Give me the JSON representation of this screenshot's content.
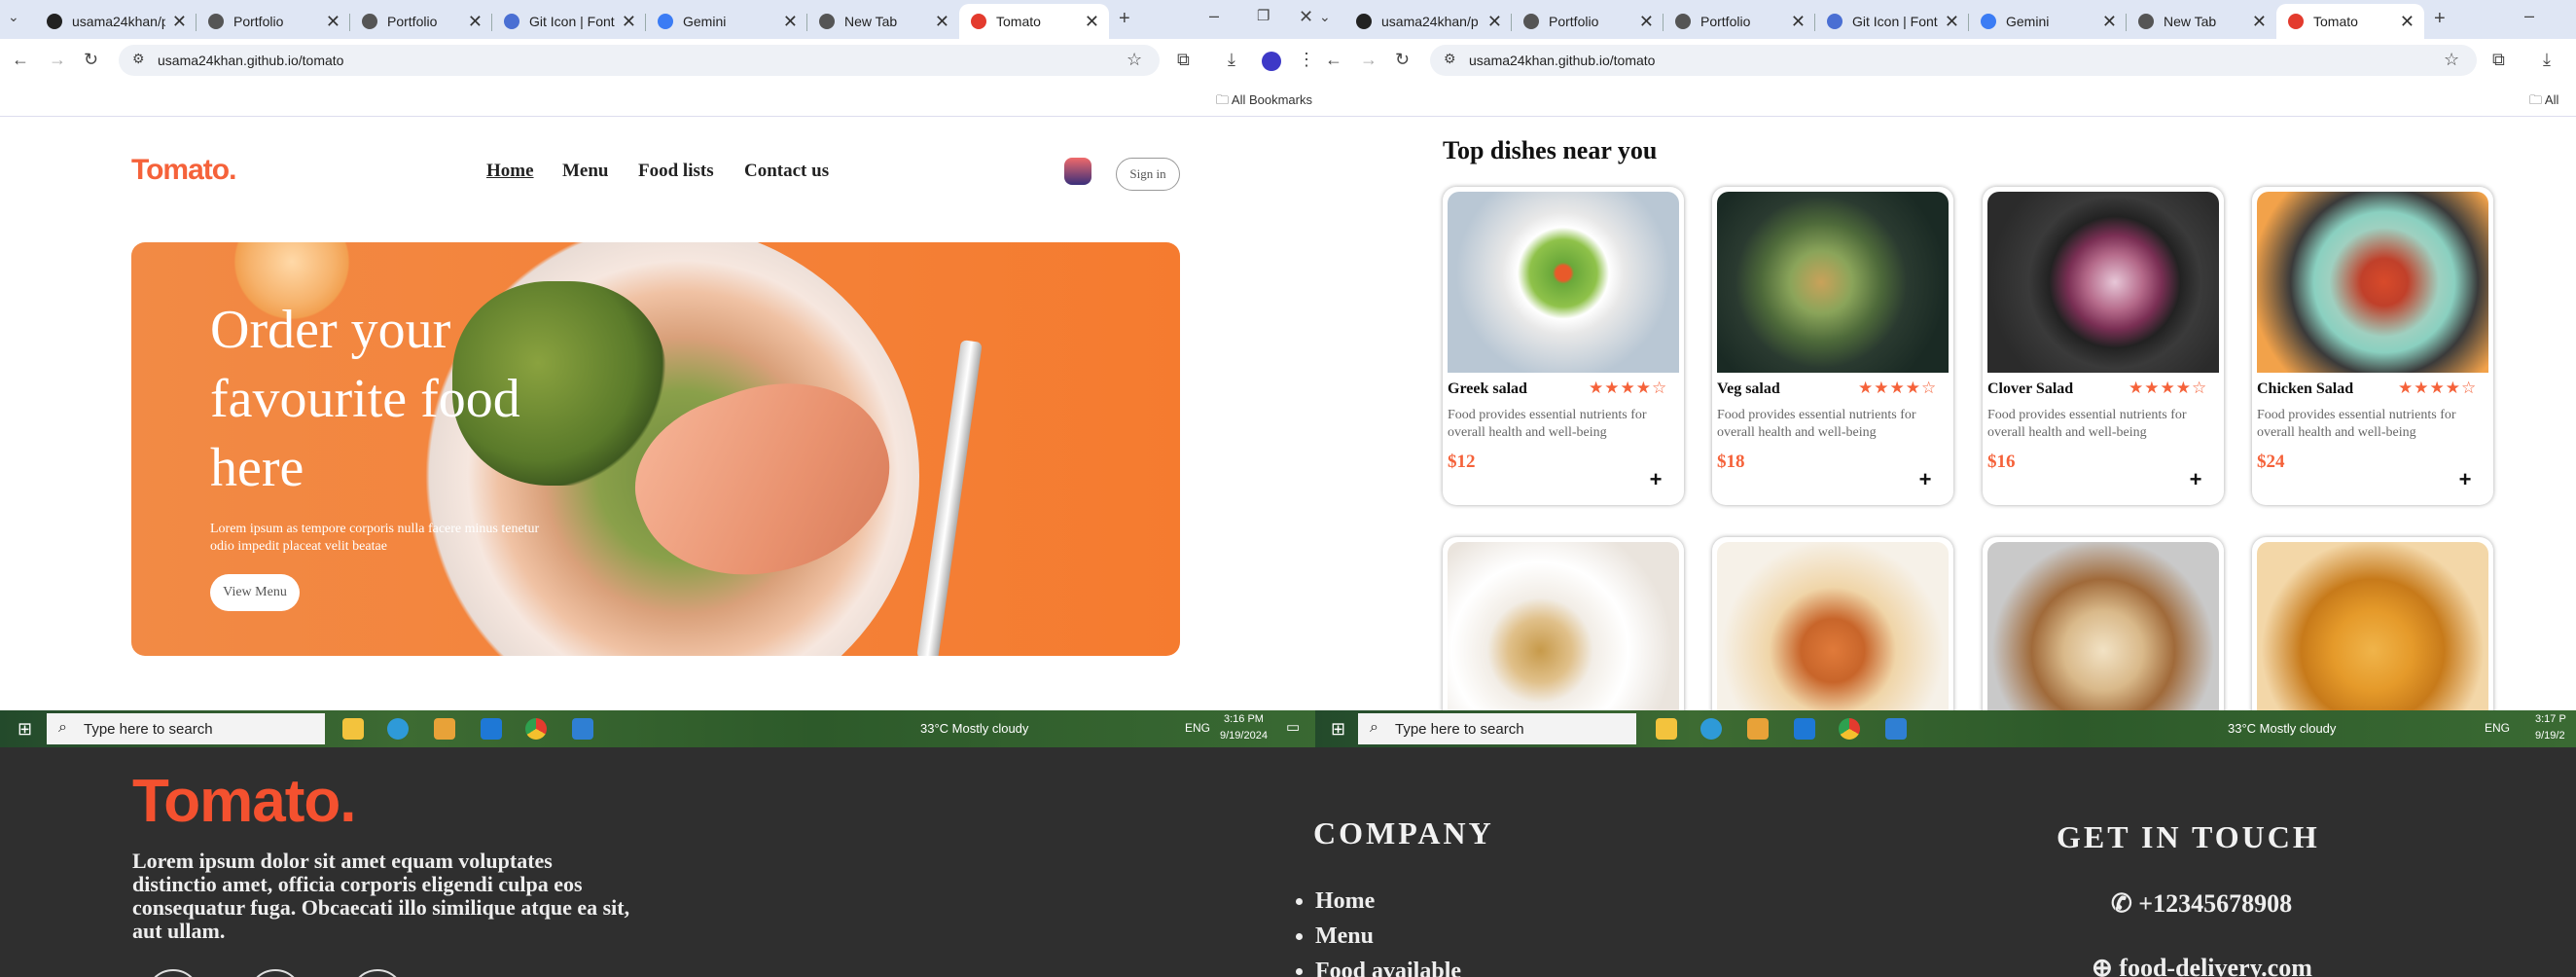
{
  "left_browser": {
    "tabs": [
      {
        "label": "usama24khan/p",
        "icon": "github-icon",
        "color": "#222222"
      },
      {
        "label": "Portfolio",
        "icon": "globe-icon",
        "color": "#555555"
      },
      {
        "label": "Portfolio",
        "icon": "globe-icon",
        "color": "#555555"
      },
      {
        "label": "Git Icon | Font A",
        "icon": "fontawesome-icon",
        "color": "#4a6fd3"
      },
      {
        "label": "Gemini",
        "icon": "gemini-icon",
        "color": "#3b7cf4"
      },
      {
        "label": "New Tab",
        "icon": "chrome-icon",
        "color": "#555555"
      },
      {
        "label": "Tomato",
        "icon": "tomato-icon",
        "color": "#e33b2e"
      }
    ],
    "url": "usama24khan.github.io/tomato",
    "bookmarks_label": "All Bookmarks"
  },
  "right_browser": {
    "tabs": [
      {
        "label": "usama24khan/p",
        "icon": "github-icon",
        "color": "#222222"
      },
      {
        "label": "Portfolio",
        "icon": "globe-icon",
        "color": "#555555"
      },
      {
        "label": "Portfolio",
        "icon": "globe-icon",
        "color": "#555555"
      },
      {
        "label": "Git Icon | Font A",
        "icon": "fontawesome-icon",
        "color": "#4a6fd3"
      },
      {
        "label": "Gemini",
        "icon": "gemini-icon",
        "color": "#3b7cf4"
      },
      {
        "label": "New Tab",
        "icon": "chrome-icon",
        "color": "#555555"
      },
      {
        "label": "Tomato",
        "icon": "tomato-icon",
        "color": "#e33b2e"
      }
    ],
    "url": "usama24khan.github.io/tomato",
    "bookmarks_label": "All"
  },
  "site": {
    "logo": "Tomato.",
    "nav": [
      "Home",
      "Menu",
      "Food lists",
      "Contact us"
    ],
    "sign_in": "Sign in",
    "hero": {
      "title_lines": [
        "Order your",
        "favourite food",
        "here"
      ],
      "subtitle_lines": [
        "Lorem ipsum as tempore corporis nulla facere minus tenetur",
        "odio impedit placeat velit beatae"
      ],
      "button": "View Menu"
    },
    "accent": "#f5623a"
  },
  "dishes": {
    "title": "Top dishes near you",
    "items": [
      {
        "name": "Greek salad",
        "desc": "Food provides essential nutrients for overall health and well-being",
        "price": "$12",
        "rating": 4
      },
      {
        "name": "Veg salad",
        "desc": "Food provides essential nutrients for overall health and well-being",
        "price": "$18",
        "rating": 4
      },
      {
        "name": "Clover Salad",
        "desc": "Food provides essential nutrients for overall health and well-being",
        "price": "$16",
        "rating": 4
      },
      {
        "name": "Chicken Salad",
        "desc": "Food provides essential nutrients for overall health and well-being",
        "price": "$24",
        "rating": 4
      }
    ],
    "add_label": "+"
  },
  "taskbar": {
    "search": "Type here to search",
    "weather": "33°C  Mostly cloudy",
    "lang": "ENG",
    "time_left": "3:16 PM",
    "date_left": "9/19/2024",
    "time_right": "3:17 P",
    "date_right": "9/19/2"
  },
  "footer": {
    "logo": "Tomato.",
    "text_lines": [
      "Lorem ipsum dolor sit amet equam voluptates",
      "distinctio amet, officia corporis eligendi culpa eos",
      "consequatur fuga. Obcaecati illo similique atque ea sit,",
      "aut ullam."
    ],
    "company_title": "COMPANY",
    "company_links": [
      "Home",
      "Menu",
      "Food available"
    ],
    "contact_title": "GET IN TOUCH",
    "phone": "+12345678908",
    "email": "food-delivery.com"
  }
}
